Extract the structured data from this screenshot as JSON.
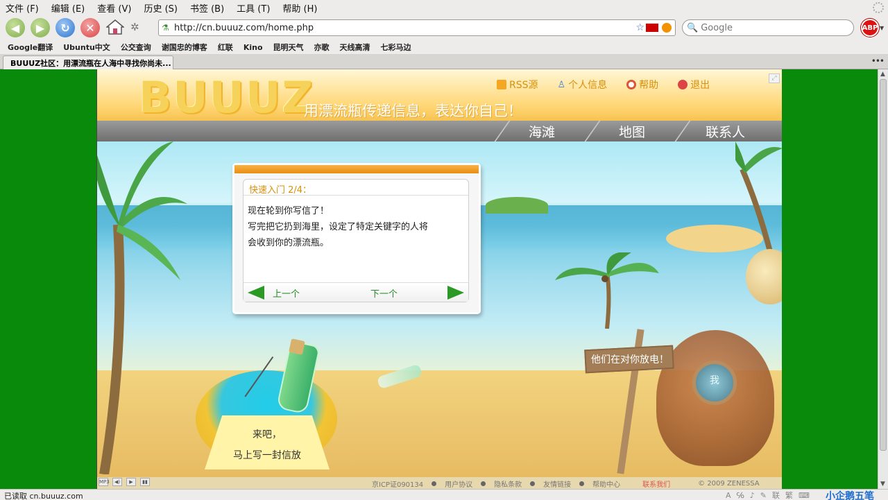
{
  "menubar": {
    "items": [
      "文件 (F)",
      "编辑 (E)",
      "查看 (V)",
      "历史 (S)",
      "书签 (B)",
      "工具 (T)",
      "帮助 (H)"
    ]
  },
  "navbar": {
    "url": "http://cn.buuuz.com/home.php",
    "search_placeholder": "Google",
    "abp_label": "ABP"
  },
  "bookmarks": [
    "Google翻译",
    "Ubuntu中文",
    "公交查询",
    "谢国忠的博客",
    "红联",
    "Kino",
    "昆明天气",
    "亦歌",
    "天线高清",
    "七彩马边"
  ],
  "tab": {
    "title": "BUUUZ社区：用漂流瓶在人海中寻找你尚未..."
  },
  "site": {
    "logo": "BUUUZ",
    "slogan": "用漂流瓶传递信息，表达你自己！",
    "top_links": {
      "rss": "RSS源",
      "profile": "个人信息",
      "help": "帮助",
      "logout": "退出"
    },
    "nav": {
      "beach": "海滩",
      "map": "地图",
      "contact": "联系人"
    },
    "dialog": {
      "title": "快速入门 2/4：",
      "line1": "现在轮到你写信了！",
      "line2": "写完把它扔到海里，设定了特定关键字的人将",
      "line3": "会收到你的漂流瓶。",
      "prev": "上一个",
      "next": "下一个"
    },
    "note": {
      "line1": "来吧，",
      "line2": "马上写一封信放"
    },
    "sign": "他们在对你放电！",
    "helmet_text": "我",
    "media": [
      "MP3",
      "◀)",
      "▶",
      "▮▮"
    ],
    "footer": {
      "icp": "京ICP证090134",
      "agreement": "用户协议",
      "privacy": "隐私条款",
      "links": "友情链接",
      "help_center": "帮助中心",
      "contact_us": "联系我们",
      "copyright": "© 2009 ZENESSA"
    }
  },
  "statusbar": {
    "text": "已读取 cn.buuuz.com",
    "tray": [
      "A",
      "℅",
      "♪",
      "✎",
      "联",
      "繁",
      "⌨"
    ],
    "ime": "小企鹅五笔"
  }
}
